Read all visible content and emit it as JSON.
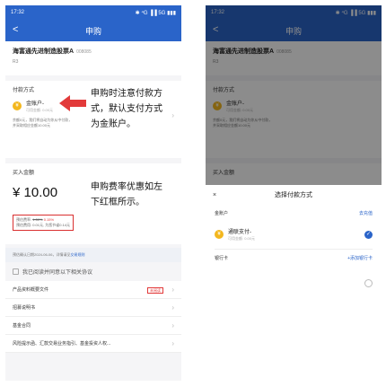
{
  "status": {
    "time": "17:32",
    "right": "✱ ⁴G ▐▐ 5G ▮▮▮"
  },
  "nav": {
    "back": "<",
    "title": "申购"
  },
  "fund": {
    "name": "海富通先进制造股票A",
    "code": "008085",
    "risk": "R3"
  },
  "payment": {
    "label": "付款方式",
    "method": "金账户-",
    "sub": "可用金额: 0.00元",
    "note": "余额0元，我们将自动为你从中付款，并采取相应金额10.00元"
  },
  "purchase": {
    "label": "买入金额",
    "amount": "¥ 10.00",
    "rate_line1_prefix": "预估费率: ",
    "rate_line1_orig": "1.50%",
    "rate_line1_new": "0.15%",
    "rate_line2": "预估费用: 0.01元, 为您节省0.14元",
    "confirm_date": "预估确认日期2024-06-06，详情请见",
    "confirm_link": "交易规则"
  },
  "agreement": {
    "text": "我已阅读并同意以下相关协议"
  },
  "docs": [
    {
      "label": "产品资料概要文件",
      "badge": "未阅读"
    },
    {
      "label": "招募说明书",
      "badge": ""
    },
    {
      "label": "基金合同",
      "badge": ""
    },
    {
      "label": "风险提示函、汇款交易业务指引、基金投资人权..."
    }
  ],
  "annotations": {
    "pay_tip": "申购时注意付款方式，默认支付方式为金账户。",
    "rate_tip": "申购费率优惠如左下红框所示。"
  },
  "sheet": {
    "title": "选择付款方式",
    "close": "×",
    "group1": "金账户",
    "recharge": "去充值",
    "option": "通联支付-",
    "option_sub": "可用金额: 0.00元",
    "group2": "银行卡",
    "add_card": "+添加银行卡"
  },
  "colors": {
    "accent": "#2a64c9",
    "red": "#e23a3a",
    "gold": "#f3b71e"
  }
}
